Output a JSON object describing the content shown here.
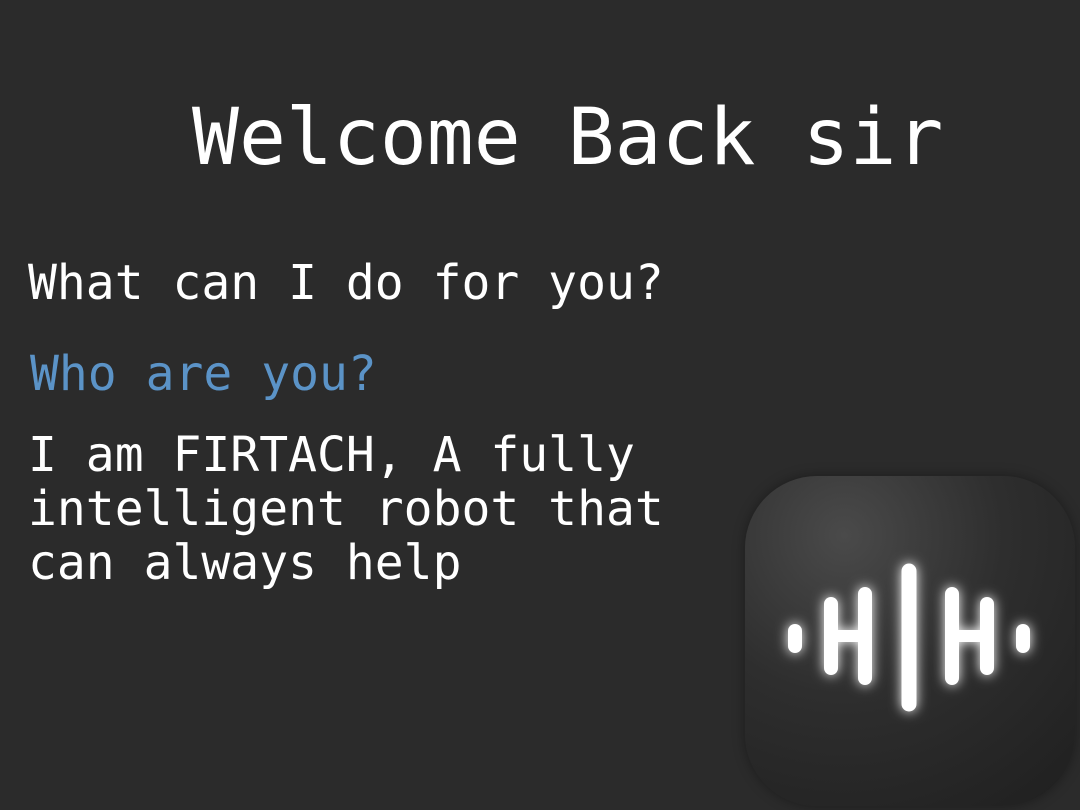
{
  "screen": {
    "greeting": "Welcome Back sir",
    "prompt": "What can I do for you?",
    "user_message": "Who are you?",
    "assistant_reply": "I am FIRTACH, A fully intelligent robot that can always help"
  },
  "app_icon": {
    "icon": "audio-waveform-icon"
  },
  "colors": {
    "background": "#2b2b2b",
    "text": "#ffffff",
    "user_message": "#5b93c7",
    "icon_tile": "#2e2e2e"
  }
}
